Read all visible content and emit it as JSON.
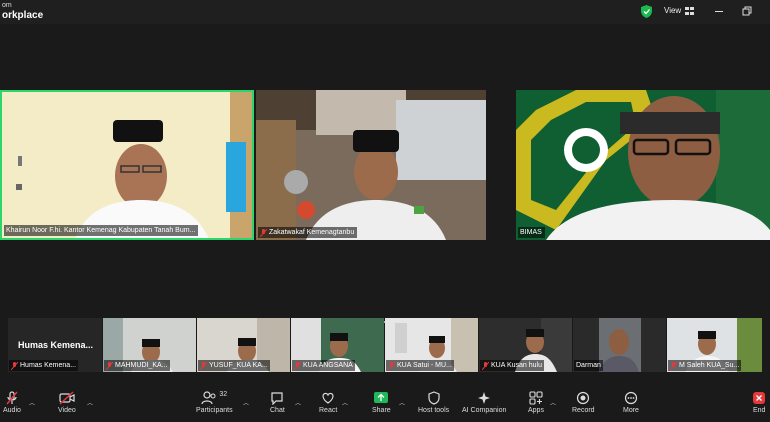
{
  "titlebar": {
    "logo_line1": "om",
    "logo_line2": "orkplace",
    "view_label": "View"
  },
  "main_tiles": [
    {
      "name": "Khairun Noor F.hi. Kantor Kemenag Kabupaten Tanah Bum..."
    },
    {
      "name": "Zakatwakaf Kemenagtanbu"
    },
    {
      "name": "BIMAS"
    }
  ],
  "thumbnails": [
    {
      "title": "Humas Kemena...",
      "name": "Humas Kemena..."
    },
    {
      "name": "MAHMUDI_KA..."
    },
    {
      "name": "YUSUF_KUA KA..."
    },
    {
      "name": "KUA ANGSANA"
    },
    {
      "name": "KUA Satui - MU..."
    },
    {
      "name": "KUA Kusan hulu"
    },
    {
      "name": "Darman"
    },
    {
      "name": "M Saleh KUA_Su..."
    }
  ],
  "toolbar": {
    "audio": "Audio",
    "video": "Video",
    "participants": "Participants",
    "participants_count": "32",
    "chat": "Chat",
    "react": "React",
    "share": "Share",
    "host_tools": "Host tools",
    "ai_companion": "AI Companion",
    "apps": "Apps",
    "record": "Record",
    "more": "More",
    "end": "End"
  },
  "colors": {
    "active_speaker_border": "#2bd66b",
    "share_green": "#1fb95a",
    "end_red": "#e5383b",
    "mic_off_red": "#e5383b"
  }
}
